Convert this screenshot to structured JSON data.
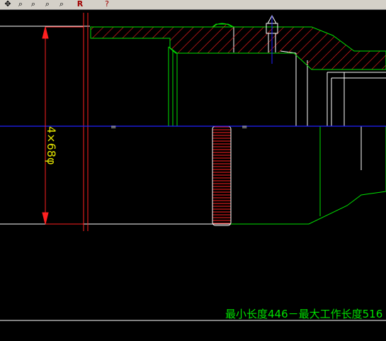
{
  "toolbar": {
    "buttons": [
      {
        "icon": "pan-icon"
      },
      {
        "icon": "zoom-icon"
      },
      {
        "icon": "zoom-window-icon"
      },
      {
        "icon": "zoom-previous-icon"
      },
      {
        "label": "R"
      },
      {
        "label": "?"
      }
    ]
  },
  "drawing": {
    "dimension_text": "4×68φ",
    "annotation": "最小长度446－最大工作长度516",
    "center_marks": [
      "=",
      "="
    ],
    "colors": {
      "background": "#000000",
      "outline": "#ffffff",
      "dimension": "#ff2020",
      "hatch": "#ff2020",
      "part_green": "#00e000",
      "centerline": "#2020ff",
      "dim_text": "#e0e000"
    }
  }
}
